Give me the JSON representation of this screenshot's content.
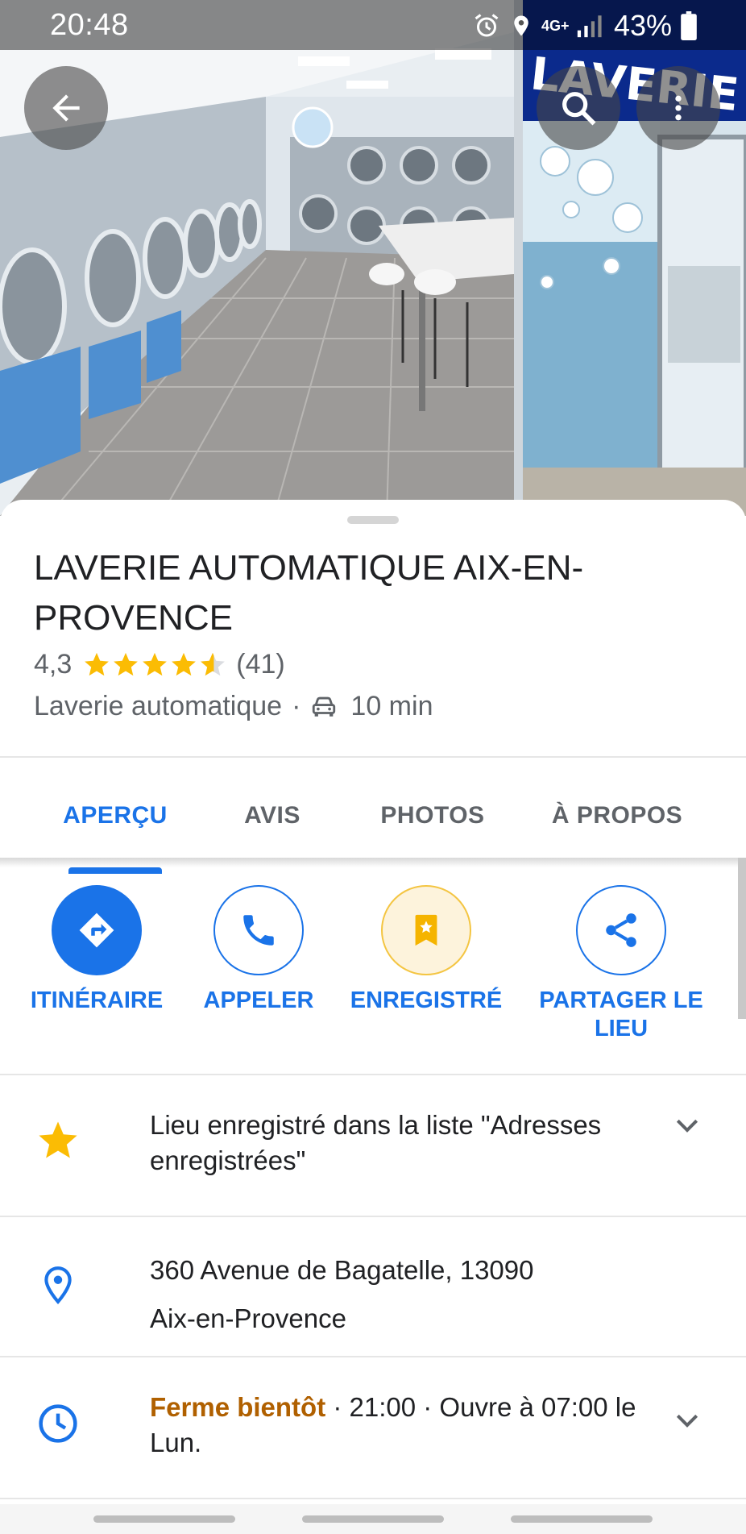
{
  "status_bar": {
    "time": "20:48",
    "network": "4G+",
    "battery": "43%",
    "icons": [
      "alarm-icon",
      "location-icon",
      "signal-icon",
      "battery-icon"
    ]
  },
  "header_buttons": {
    "back_icon": "arrow-left-icon",
    "search_icon": "search-icon",
    "more_icon": "more-vert-icon"
  },
  "place": {
    "name": "LAVERIE AUTOMATIQUE AIX-EN-PROVENCE",
    "rating": "4,3",
    "rating_value": 4.3,
    "rating_max": 5,
    "review_count": "(41)",
    "category": "Laverie automatique",
    "separator": "·",
    "travel_mode_icon": "car-icon",
    "travel_time": "10 min"
  },
  "tabs": [
    {
      "label": "APERÇU",
      "active": true
    },
    {
      "label": "AVIS",
      "active": false
    },
    {
      "label": "PHOTOS",
      "active": false
    },
    {
      "label": "À PROPOS",
      "active": false
    }
  ],
  "actions": [
    {
      "label": "ITINÉRAIRE",
      "icon": "directions-icon"
    },
    {
      "label": "APPELER",
      "icon": "phone-icon"
    },
    {
      "label": "ENREGISTRÉ",
      "icon": "bookmark-star-icon"
    },
    {
      "label": "PARTAGER LE LIEU",
      "icon": "share-icon"
    }
  ],
  "info": {
    "saved": {
      "icon": "star-icon",
      "text": "Lieu enregistré dans la liste \"Adresses enregistrées\""
    },
    "address": {
      "icon": "location-pin-icon",
      "line1": "360 Avenue de Bagatelle, 13090",
      "line2": "Aix-en-Provence"
    },
    "hours": {
      "icon": "clock-icon",
      "status": "Ferme bientôt",
      "detail": " · 21:00 · Ouvre à 07:00 le Lun."
    }
  },
  "colors": {
    "accent": "#1a73e8",
    "star": "#fbbc04",
    "closing": "#b06000",
    "secondary_text": "#5f6368"
  }
}
